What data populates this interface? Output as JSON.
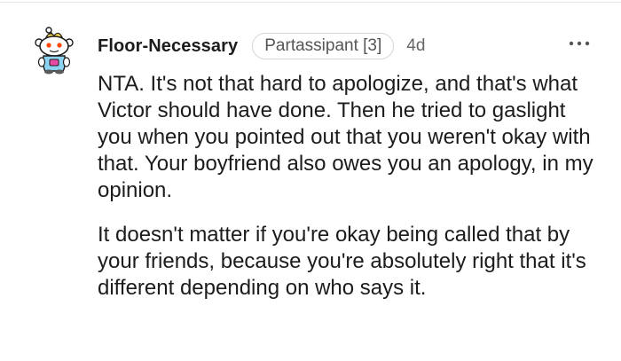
{
  "comment": {
    "author": "Floor-Necessary",
    "flair": "Partassipant [3]",
    "time": "4d",
    "paragraphs": [
      "NTA. It's not that hard to apologize, and that's what Victor should have done. Then he tried to gaslight you when you pointed out that you weren't okay with that. Your boyfriend also owes you an apology, in my opinion.",
      "It doesn't matter if you're okay being called that by your friends, because you're absolutely right that it's different depending on who says it."
    ]
  },
  "icons": {
    "avatar": "snoo-avatar-icon",
    "more": "more-options-icon"
  },
  "colors": {
    "text": "#1c1c1c",
    "muted": "#666666",
    "flair_border": "#d6d6d6"
  }
}
